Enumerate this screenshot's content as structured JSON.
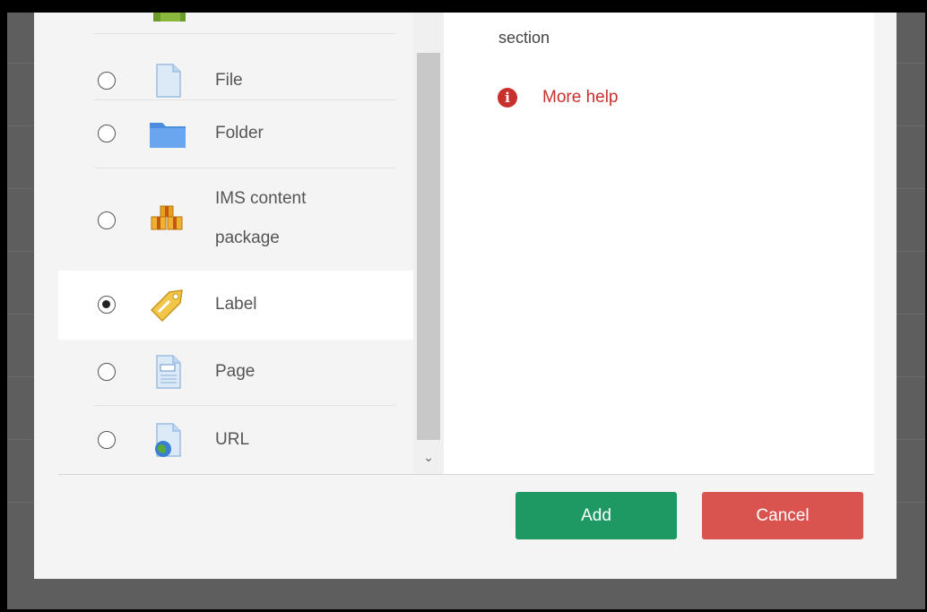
{
  "modules": [
    {
      "label": "File",
      "icon": "file-icon",
      "selected": false
    },
    {
      "label": "Folder",
      "icon": "folder-icon",
      "selected": false
    },
    {
      "label": "IMS content\npackage",
      "icon": "ims-package-icon",
      "selected": false
    },
    {
      "label": "Label",
      "icon": "label-tag-icon",
      "selected": true
    },
    {
      "label": "Page",
      "icon": "page-icon",
      "selected": false
    },
    {
      "label": "URL",
      "icon": "url-globe-icon",
      "selected": false
    }
  ],
  "help": {
    "text": "section",
    "more_help": "More help",
    "icon": "info-icon"
  },
  "footer": {
    "add_label": "Add",
    "cancel_label": "Cancel"
  },
  "colors": {
    "add_button": "#1e9963",
    "cancel_button": "#d9534f",
    "help_link": "#c9302c"
  }
}
